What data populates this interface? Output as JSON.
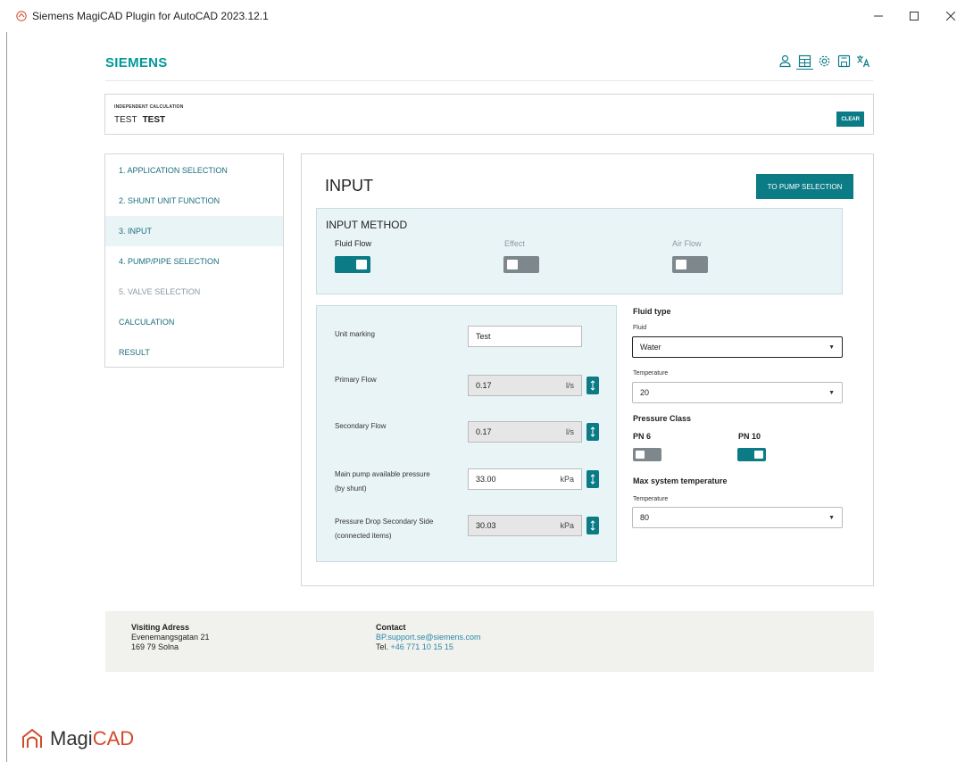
{
  "window": {
    "title": "Siemens MagiCAD Plugin for AutoCAD 2023.12.1"
  },
  "header": {
    "brand": "SIEMENS",
    "icons": [
      "user-icon",
      "calculator-icon",
      "gear-icon",
      "save-icon",
      "translate-icon"
    ]
  },
  "calc": {
    "label": "INDEPENDENT CALCULATION",
    "name_1": "TEST",
    "name_2": "TEST",
    "clear_label": "CLEAR"
  },
  "sidebar": {
    "items": [
      {
        "label": "1. APPLICATION SELECTION",
        "state": "enabled"
      },
      {
        "label": "2. SHUNT UNIT FUNCTION",
        "state": "enabled"
      },
      {
        "label": "3. INPUT",
        "state": "active"
      },
      {
        "label": "4. PUMP/PIPE SELECTION",
        "state": "enabled"
      },
      {
        "label": "5. VALVE SELECTION",
        "state": "disabled"
      },
      {
        "label": "CALCULATION",
        "state": "enabled"
      },
      {
        "label": "RESULT",
        "state": "enabled"
      }
    ]
  },
  "main": {
    "title": "INPUT",
    "next_button": "TO PUMP SELECTION"
  },
  "input_method": {
    "title": "INPUT METHOD",
    "options": [
      {
        "label": "Fluid Flow",
        "on": true
      },
      {
        "label": "Effect",
        "on": false
      },
      {
        "label": "Air Flow",
        "on": false
      }
    ]
  },
  "fields": {
    "unit_marking": {
      "label": "Unit marking",
      "value": "Test"
    },
    "primary_flow": {
      "label": "Primary Flow",
      "value": "0.17",
      "unit": "l/s"
    },
    "secondary_flow": {
      "label": "Secondary Flow",
      "value": "0.17",
      "unit": "l/s"
    },
    "main_pump": {
      "label_1": "Main pump available pressure",
      "label_2": "(by shunt)",
      "value": "33.00",
      "unit": "kPa"
    },
    "pressure_drop": {
      "label_1": "Pressure Drop Secondary Side",
      "label_2": "(connected items)",
      "value": "30.03",
      "unit": "kPa"
    }
  },
  "fluid": {
    "heading": "Fluid type",
    "fluid_label": "Fluid",
    "fluid_value": "Water",
    "temp_label": "Temperature",
    "temp_value": "20"
  },
  "pressure_class": {
    "heading": "Pressure Class",
    "pn6": {
      "label": "PN 6",
      "on": false
    },
    "pn10": {
      "label": "PN 10",
      "on": true
    }
  },
  "max_temp": {
    "heading": "Max system temperature",
    "temp_label": "Temperature",
    "temp_value": "80"
  },
  "footer": {
    "visiting_heading": "Visiting Adress",
    "street": "Evenemangsgatan 21",
    "city": "169 79 Solna",
    "contact_heading": "Contact",
    "email": "BP.support.se@siemens.com",
    "tel_prefix": "Tel.",
    "tel": "+46 771 10 15 15"
  },
  "brand_footer": {
    "part1": "Magi",
    "part2": "CAD"
  },
  "colors": {
    "accent": "#0b7b86",
    "panel_bg": "#e9f4f6",
    "toggle_off": "#7d878c",
    "brand": "#009999"
  }
}
